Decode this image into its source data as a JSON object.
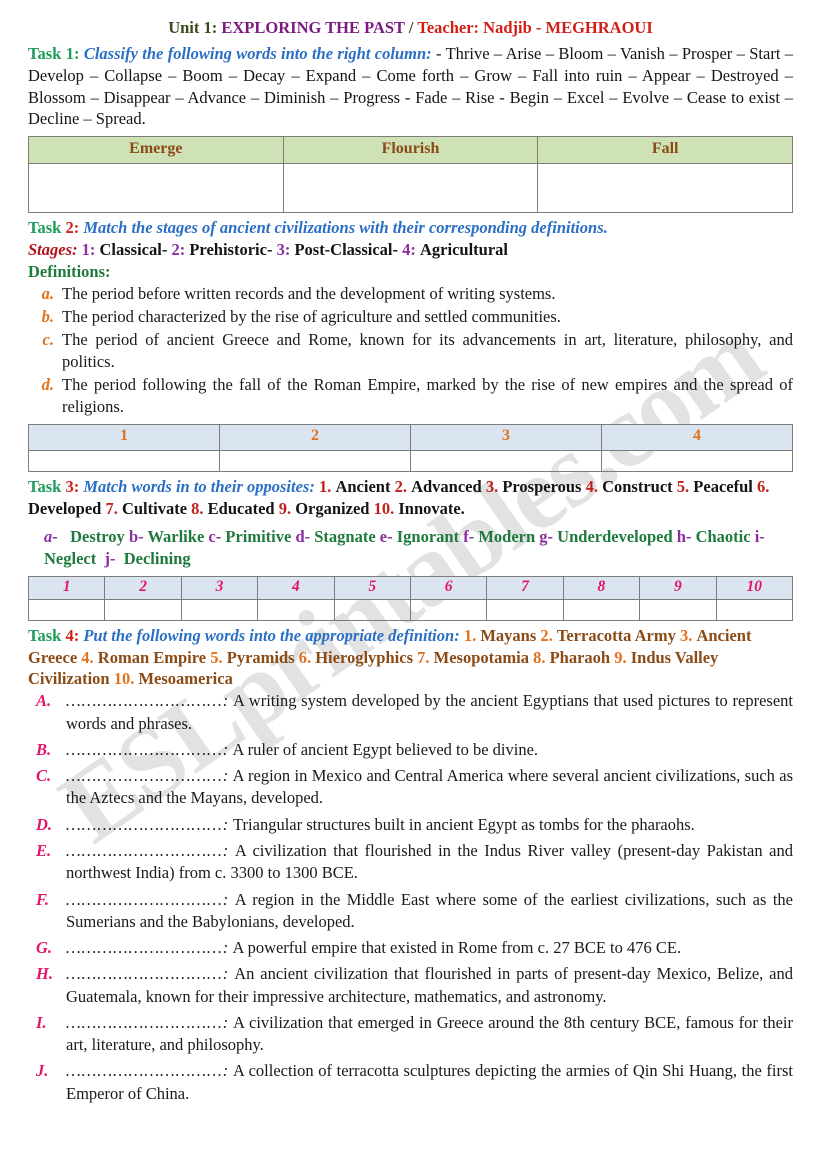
{
  "watermark": "ESLprintables.com",
  "header": {
    "unit_label": "Unit 1:",
    "unit_title": "EXPLORING THE PAST",
    "separator": "/",
    "teacher": "Teacher: Nadjib - MEGHRAOUI"
  },
  "task1": {
    "label": "Task 1:",
    "instruction": "Classify the following words into the right column:",
    "dash": "-",
    "words": "Thrive – Arise – Bloom – Vanish – Prosper – Start – Develop – Collapse – Boom – Decay – Expand – Come forth – Grow – Fall into ruin – Appear – Destroyed – Blossom – Disappear – Advance – Diminish – Progress - Fade – Rise - Begin – Excel – Evolve – Cease to exist – Decline – Spread.",
    "table_headers": [
      "Emerge",
      "Flourish",
      "Fall"
    ],
    "table_row": [
      "",
      "",
      ""
    ],
    "header_bg": "#cfe2b6",
    "header_color": "#8a4b16"
  },
  "task2": {
    "label_task": "Task",
    "label_num": "2:",
    "instruction": "Match the stages of ancient civilizations with their corresponding definitions.",
    "stages_label": "Stages:",
    "stages": [
      {
        "num": "1:",
        "name": "Classical"
      },
      {
        "num": "2:",
        "name": "Prehistoric"
      },
      {
        "num": "3:",
        "name": "Post-Classical"
      },
      {
        "num": "4:",
        "name": "Agricultural"
      }
    ],
    "stages_sep": "-",
    "definitions_label": "Definitions:",
    "definitions": [
      {
        "marker": "a.",
        "text": "The period before written records and the development of writing systems."
      },
      {
        "marker": "b.",
        "text": "The period characterized by the rise of agriculture and settled communities."
      },
      {
        "marker": "c.",
        "text": "The period of ancient Greece and Rome, known for its advancements in art, literature, philosophy, and politics."
      },
      {
        "marker": "d.",
        "text": "The period following the fall of the Roman Empire, marked by the rise of new empires and the spread of religions."
      }
    ],
    "table_headers": [
      "1",
      "2",
      "3",
      "4"
    ],
    "table_row": [
      "",
      "",
      "",
      ""
    ],
    "header_bg": "#dbe5f1",
    "header_color": "#e2711d"
  },
  "task3": {
    "label_task": "Task",
    "label_num": "3:",
    "instruction": "Match words in to their opposites:",
    "words": [
      {
        "num": "1.",
        "text": "Ancient"
      },
      {
        "num": "2.",
        "text": "Advanced"
      },
      {
        "num": "3.",
        "text": "Prosperous"
      },
      {
        "num": "4.",
        "text": "Construct"
      },
      {
        "num": "5.",
        "text": "Peaceful"
      },
      {
        "num": "6.",
        "text": "Developed"
      },
      {
        "num": "7.",
        "text": "Cultivate"
      },
      {
        "num": "8.",
        "text": "Educated"
      },
      {
        "num": "9.",
        "text": "Organized"
      },
      {
        "num": "10.",
        "text": "Innovate."
      }
    ],
    "opposites": [
      {
        "letter": "a-",
        "text": "Destroy"
      },
      {
        "letter": "b-",
        "text": "Warlike"
      },
      {
        "letter": "c-",
        "text": "Primitive"
      },
      {
        "letter": "d-",
        "text": "Stagnate"
      },
      {
        "letter": "e-",
        "text": "Ignorant"
      },
      {
        "letter": "f-",
        "text": "Modern"
      },
      {
        "letter": "g-",
        "text": "Underdeveloped"
      },
      {
        "letter": "h-",
        "text": "Chaotic"
      },
      {
        "letter": "i-",
        "text": "Neglect"
      },
      {
        "letter": "j-",
        "text": "Declining"
      }
    ],
    "table_headers": [
      "1",
      "2",
      "3",
      "4",
      "5",
      "6",
      "7",
      "8",
      "9",
      "10"
    ],
    "table_row": [
      "",
      "",
      "",
      "",
      "",
      "",
      "",
      "",
      "",
      ""
    ],
    "header_bg": "#dbe5f1",
    "header_color": "#e4146b"
  },
  "task4": {
    "label_task": "Task",
    "label_num": "4:",
    "instruction": "Put the following words into the appropriate definition:",
    "words": [
      {
        "num": "1.",
        "text": "Mayans"
      },
      {
        "num": "2.",
        "text": "Terracotta Army"
      },
      {
        "num": "3.",
        "text": "Ancient Greece"
      },
      {
        "num": "4.",
        "text": "Roman Empire"
      },
      {
        "num": "5.",
        "text": "Pyramids"
      },
      {
        "num": "6.",
        "text": "Hieroglyphics"
      },
      {
        "num": "7.",
        "text": "Mesopotamia"
      },
      {
        "num": "8.",
        "text": "Pharaoh"
      },
      {
        "num": "9.",
        "text": "Indus Valley Civilization"
      },
      {
        "num": "10.",
        "text": "Mesoamerica"
      }
    ],
    "blank_dots": "…………………………:",
    "answers": [
      {
        "marker": "A.",
        "text": "A writing system developed by the ancient Egyptians that used pictures to represent words and phrases."
      },
      {
        "marker": "B.",
        "text": "A ruler of ancient Egypt believed to be divine."
      },
      {
        "marker": "C.",
        "text": "A region in Mexico and Central America where several ancient civilizations, such as the Aztecs and the Mayans, developed."
      },
      {
        "marker": "D.",
        "text": "Triangular structures built in ancient Egypt as tombs for the pharaohs."
      },
      {
        "marker": "E.",
        "text": "A civilization that flourished in the Indus River valley (present-day Pakistan and northwest India) from c. 3300 to 1300 BCE."
      },
      {
        "marker": "F.",
        "text": "A region in the Middle East where some of the earliest civilizations, such as the Sumerians and the Babylonians, developed."
      },
      {
        "marker": "G.",
        "text": "A powerful empire that existed in Rome from c. 27 BCE to 476 CE."
      },
      {
        "marker": "H.",
        "text": "An ancient civilization that flourished in parts of present-day Mexico, Belize, and Guatemala, known for their impressive architecture, mathematics, and astronomy."
      },
      {
        "marker": "I.",
        "text": "A civilization that emerged in Greece around the 8th century BCE, famous for their art, literature, and philosophy."
      },
      {
        "marker": "J.",
        "text": "A collection of terracotta sculptures depicting the armies of Qin Shi Huang, the first Emperor of China."
      }
    ]
  }
}
